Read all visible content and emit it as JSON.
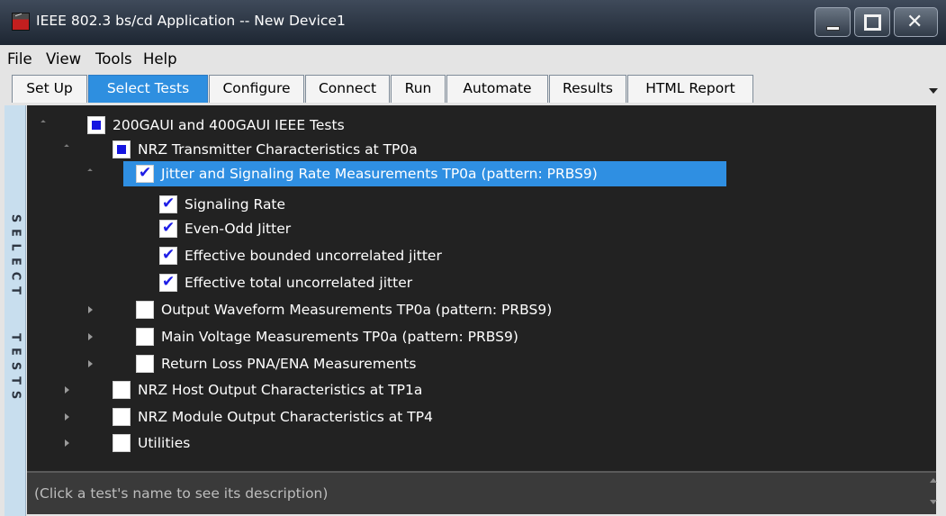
{
  "window": {
    "title": "IEEE 802.3 bs/cd Application -- New Device1"
  },
  "menu": [
    "File",
    "View",
    "Tools",
    "Help"
  ],
  "tabs": [
    {
      "label": "Set Up",
      "active": false
    },
    {
      "label": "Select Tests",
      "active": true
    },
    {
      "label": "Configure",
      "active": false
    },
    {
      "label": "Connect",
      "active": false
    },
    {
      "label": "Run",
      "active": false
    },
    {
      "label": "Automate",
      "active": false
    },
    {
      "label": "Results",
      "active": false
    },
    {
      "label": "HTML Report",
      "active": false
    }
  ],
  "side_label": "SELECT TESTS",
  "tree": [
    {
      "label": "200GAUI and 400GAUI IEEE Tests",
      "level": 0,
      "expander": "open",
      "state": "partial"
    },
    {
      "label": "NRZ Transmitter Characteristics at TP0a",
      "level": 1,
      "expander": "open",
      "state": "partial"
    },
    {
      "label": "Jitter and Signaling Rate Measurements TP0a (pattern: PRBS9)",
      "level": 2,
      "expander": "open",
      "state": "checked",
      "selected": true
    },
    {
      "label": "Signaling Rate",
      "level": 3,
      "expander": "none",
      "state": "checked"
    },
    {
      "label": "Even-Odd Jitter",
      "level": 3,
      "expander": "none",
      "state": "checked"
    },
    {
      "label": "Effective bounded uncorrelated jitter",
      "level": 3,
      "expander": "none",
      "state": "checked"
    },
    {
      "label": "Effective total uncorrelated jitter",
      "level": 3,
      "expander": "none",
      "state": "checked"
    },
    {
      "label": "Output Waveform Measurements TP0a (pattern: PRBS9)",
      "level": 2,
      "expander": "closed",
      "state": "unchecked"
    },
    {
      "label": "Main Voltage Measurements TP0a (pattern: PRBS9)",
      "level": 2,
      "expander": "closed",
      "state": "unchecked"
    },
    {
      "label": "Return Loss PNA/ENA Measurements",
      "level": 2,
      "expander": "closed",
      "state": "unchecked"
    },
    {
      "label": "NRZ Host Output Characteristics at TP1a",
      "level": 1,
      "expander": "closed",
      "state": "unchecked"
    },
    {
      "label": "NRZ Module Output Characteristics at TP4",
      "level": 1,
      "expander": "closed",
      "state": "unchecked"
    },
    {
      "label": "Utilities",
      "level": 1,
      "expander": "closed",
      "state": "unchecked"
    }
  ],
  "description": "(Click a test's name to see its description)",
  "colors": {
    "accent": "#2e8fe0",
    "tree_background": "#222222",
    "check_blue": "#1d1de6"
  }
}
